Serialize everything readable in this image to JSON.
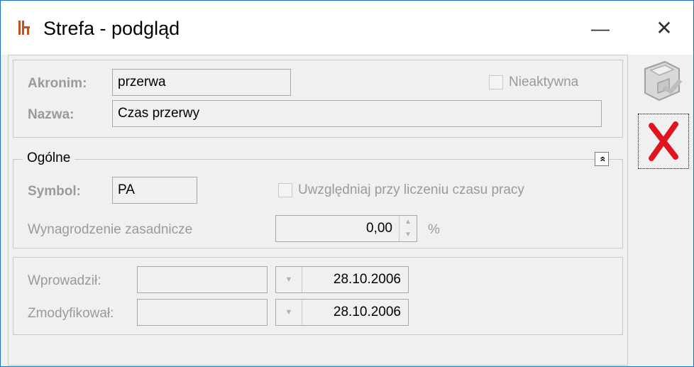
{
  "window": {
    "title": "Strefa - podgląd",
    "minimize_glyph": "—",
    "close_glyph": "✕"
  },
  "header": {
    "akronim_label": "Akronim:",
    "akronim_value": "przerwa",
    "nieaktywna_label": "Nieaktywna",
    "nazwa_label": "Nazwa:",
    "nazwa_value": "Czas przerwy"
  },
  "general": {
    "group_title": "Ogólne",
    "collapse_glyph": "»",
    "symbol_label": "Symbol:",
    "symbol_value": "PA",
    "uwzgledniaj_label": "Uwzględniaj przy liczeniu czasu pracy",
    "wynagrodzenie_label": "Wynagrodzenie zasadnicze",
    "wynagrodzenie_value": "0,00",
    "percent_label": "%"
  },
  "audit": {
    "wprowadzil_label": "Wprowadził:",
    "wprowadzil_user": "",
    "wprowadzil_date": "28.10.2006",
    "zmodyfikowal_label": "Zmodyfikował:",
    "zmodyfikowal_user": "",
    "zmodyfikowal_date": "28.10.2006"
  },
  "icons": {
    "save": "save-icon",
    "cancel": "cancel-icon",
    "app": "app-icon"
  },
  "colors": {
    "accent_border": "#1a6ec7",
    "cancel_red": "#e0141e",
    "disabled_text": "#9a9a9a"
  }
}
